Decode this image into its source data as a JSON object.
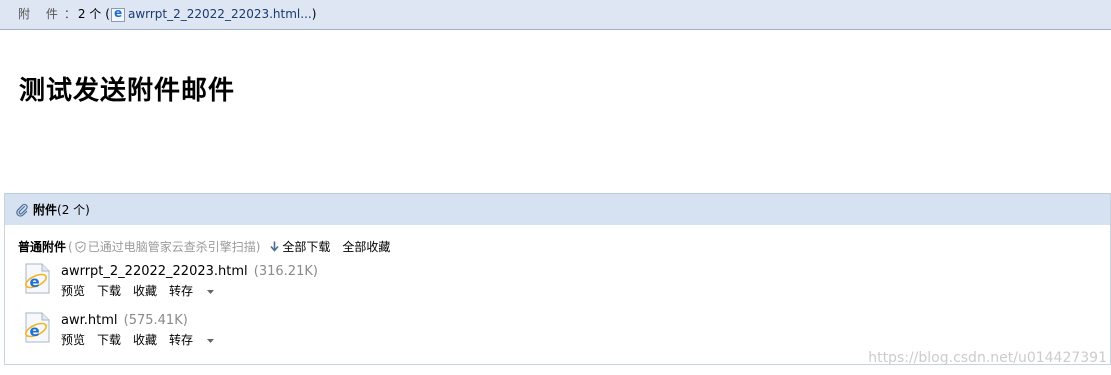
{
  "summary": {
    "label": "附 件",
    "colon": "：",
    "count": "2 个",
    "open_paren": "(",
    "filename": "awrrpt_2_22022_22023.html...",
    "close_paren": ")"
  },
  "subject": "测试发送附件邮件",
  "attachments": {
    "header_title": "附件",
    "header_count": "(2 个)",
    "bar": {
      "type": "普通附件",
      "scan_open": "(",
      "scan_text": "已通过电脑管家云查杀引擎扫描",
      "scan_close": ")",
      "download_all": "全部下载",
      "favorite_all": "全部收藏"
    },
    "items": [
      {
        "name": "awrrpt_2_22022_22023.html",
        "size": "(316.21K)",
        "actions": [
          "预览",
          "下载",
          "收藏",
          "转存"
        ]
      },
      {
        "name": "awr.html",
        "size": "(575.41K)",
        "actions": [
          "预览",
          "下载",
          "收藏",
          "转存"
        ]
      }
    ]
  },
  "watermark": "https://blog.csdn.net/u014427391",
  "icons": {
    "file_type": "ie-html-file-icon",
    "clip": "paperclip-icon",
    "shield": "shield-icon",
    "download": "download-arrow-icon"
  }
}
